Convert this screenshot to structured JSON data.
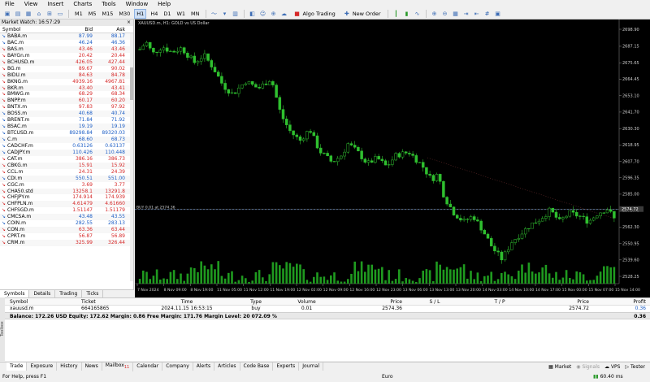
{
  "menu": [
    "File",
    "View",
    "Insert",
    "Charts",
    "Tools",
    "Window",
    "Help"
  ],
  "toolbar": {
    "timeframes": [
      "M1",
      "M5",
      "M15",
      "M30",
      "H1",
      "H4",
      "D1",
      "W1",
      "MN"
    ],
    "active_timeframe": "H1",
    "algo_trading": "Algo Trading",
    "new_order": "New Order"
  },
  "market_watch": {
    "title": "Market Watch: 16:57:29",
    "headers": {
      "symbol": "Symbol",
      "bid": "Bid",
      "ask": "Ask"
    },
    "rows": [
      {
        "symbol": "BABA.m",
        "bid": "87.99",
        "ask": "88.17",
        "dir": "down",
        "color": "up"
      },
      {
        "symbol": "BAC.m",
        "bid": "46.24",
        "ask": "46.36",
        "dir": "down",
        "color": "up"
      },
      {
        "symbol": "BAS.m",
        "bid": "43.46",
        "ask": "43.46",
        "dir": "down",
        "color": "dn"
      },
      {
        "symbol": "BAYGn.m",
        "bid": "20.42",
        "ask": "20.44",
        "dir": "down",
        "color": "dn"
      },
      {
        "symbol": "BCHUSD.m",
        "bid": "426.05",
        "ask": "427.44",
        "dir": "down",
        "color": "dn"
      },
      {
        "symbol": "BG.m",
        "bid": "89.67",
        "ask": "90.02",
        "dir": "down",
        "color": "dn"
      },
      {
        "symbol": "BIDU.m",
        "bid": "84.63",
        "ask": "84.78",
        "dir": "down",
        "color": "dn"
      },
      {
        "symbol": "BKNG.m",
        "bid": "4939.16",
        "ask": "4967.81",
        "dir": "down",
        "color": "dn"
      },
      {
        "symbol": "BKR.m",
        "bid": "43.40",
        "ask": "43.41",
        "dir": "down",
        "color": "dn"
      },
      {
        "symbol": "BMWG.m",
        "bid": "68.29",
        "ask": "68.34",
        "dir": "down",
        "color": "dn"
      },
      {
        "symbol": "BNPP.m",
        "bid": "60.17",
        "ask": "60.20",
        "dir": "down",
        "color": "dn"
      },
      {
        "symbol": "BNTX.m",
        "bid": "97.83",
        "ask": "97.92",
        "dir": "down",
        "color": "dn"
      },
      {
        "symbol": "BOSS.m",
        "bid": "40.68",
        "ask": "40.74",
        "dir": "down",
        "color": "up"
      },
      {
        "symbol": "BRENT.m",
        "bid": "71.84",
        "ask": "71.92",
        "dir": "down",
        "color": "up"
      },
      {
        "symbol": "BSAC.m",
        "bid": "19.19",
        "ask": "19.19",
        "dir": "down",
        "color": "up"
      },
      {
        "symbol": "BTCUSD.m",
        "bid": "89298.84",
        "ask": "89320.03",
        "dir": "down",
        "color": "up"
      },
      {
        "symbol": "C.m",
        "bid": "68.60",
        "ask": "68.73",
        "dir": "down",
        "color": "up"
      },
      {
        "symbol": "CADCHF.m",
        "bid": "0.63126",
        "ask": "0.63137",
        "dir": "down",
        "color": "up"
      },
      {
        "symbol": "CADJPY.m",
        "bid": "110.426",
        "ask": "110.448",
        "dir": "down",
        "color": "up"
      },
      {
        "symbol": "CAT.m",
        "bid": "386.16",
        "ask": "386.73",
        "dir": "down",
        "color": "dn"
      },
      {
        "symbol": "CBKG.m",
        "bid": "15.91",
        "ask": "15.92",
        "dir": "down",
        "color": "dn"
      },
      {
        "symbol": "CCL.m",
        "bid": "24.31",
        "ask": "24.39",
        "dir": "down",
        "color": "dn"
      },
      {
        "symbol": "CDI.m",
        "bid": "550.51",
        "ask": "551.00",
        "dir": "down",
        "color": "up"
      },
      {
        "symbol": "CGC.m",
        "bid": "3.69",
        "ask": "3.77",
        "dir": "down",
        "color": "dn"
      },
      {
        "symbol": "CHA50.std",
        "bid": "13258.1",
        "ask": "13291.8",
        "dir": "down",
        "color": "dn"
      },
      {
        "symbol": "CHFJPY.m",
        "bid": "174.914",
        "ask": "174.939",
        "dir": "down",
        "color": "dn"
      },
      {
        "symbol": "CHFPLN.m",
        "bid": "4.61479",
        "ask": "4.61660",
        "dir": "down",
        "color": "dn"
      },
      {
        "symbol": "CHFSGD.m",
        "bid": "1.51147",
        "ask": "1.51179",
        "dir": "down",
        "color": "dn"
      },
      {
        "symbol": "CMCSA.m",
        "bid": "43.48",
        "ask": "43.55",
        "dir": "down",
        "color": "up"
      },
      {
        "symbol": "COIN.m",
        "bid": "282.55",
        "ask": "283.13",
        "dir": "down",
        "color": "up"
      },
      {
        "symbol": "CON.m",
        "bid": "63.36",
        "ask": "63.44",
        "dir": "down",
        "color": "dn"
      },
      {
        "symbol": "CPRT.m",
        "bid": "56.87",
        "ask": "56.89",
        "dir": "down",
        "color": "dn"
      },
      {
        "symbol": "CRM.m",
        "bid": "325.99",
        "ask": "326.44",
        "dir": "down",
        "color": "dn"
      }
    ],
    "tabs": [
      "Symbols",
      "Details",
      "Trading",
      "Ticks"
    ],
    "active_tab": "Symbols"
  },
  "chart": {
    "title": "XAUUSD.m, H1:  GOLD vs US Dollar",
    "trade_label": "BUY 0.01 at 2574.36",
    "price_ticks": [
      "2698.90",
      "2687.15",
      "2675.65",
      "2664.45",
      "2653.10",
      "2641.70",
      "2630.30",
      "2618.95",
      "2607.70",
      "2596.35",
      "2585.00",
      "2573.70",
      "2562.30",
      "2550.95",
      "2539.60",
      "2528.25"
    ],
    "current_price": "2574.72",
    "time_ticks": [
      "7 Nov 2024",
      "8 Nov 09:00",
      "8 Nov 19:00",
      "11 Nov 05:00",
      "11 Nov 12:00",
      "11 Nov 19:00",
      "12 Nov 02:00",
      "12 Nov 09:00",
      "12 Nov 16:00",
      "12 Nov 23:00",
      "13 Nov 06:00",
      "13 Nov 13:00",
      "13 Nov 20:00",
      "14 Nov 03:00",
      "14 Nov 10:00",
      "14 Nov 17:00",
      "15 Nov 00:00",
      "15 Nov 07:00",
      "15 Nov 14:00"
    ]
  },
  "terminal": {
    "headers": [
      "Symbol",
      "Ticket",
      "Time",
      "Type",
      "Volume",
      "Price",
      "S / L",
      "T / P",
      "Price",
      "Profit"
    ],
    "row": {
      "symbol": "xauusd.m",
      "ticket": "664165865",
      "time": "2024.11.15 16:53:15",
      "type": "buy",
      "volume": "0.01",
      "price": "2574.36",
      "sl": "",
      "tp": "",
      "cur_price": "2574.72",
      "profit": "0.36"
    },
    "balance": "Balance: 172.26 USD   Equity: 172.62   Margin: 0.86   Free Margin: 171.76   Margin Level: 20 072.09 %",
    "balance_profit": "0.36"
  },
  "bottom_tabs": [
    "Trade",
    "Exposure",
    "History",
    "News",
    "Mailbox",
    "Calendar",
    "Company",
    "Alerts",
    "Articles",
    "Code Base",
    "Experts",
    "Journal"
  ],
  "mailbox_count": "11",
  "bottom_right": {
    "market": "Market",
    "signals": "Signals",
    "vps": "VPS",
    "tester": "Tester"
  },
  "toolbox_label": "Toolbox",
  "status": {
    "help": "For Help, press F1",
    "profile": "Euro",
    "ping": "60.40 ms"
  }
}
